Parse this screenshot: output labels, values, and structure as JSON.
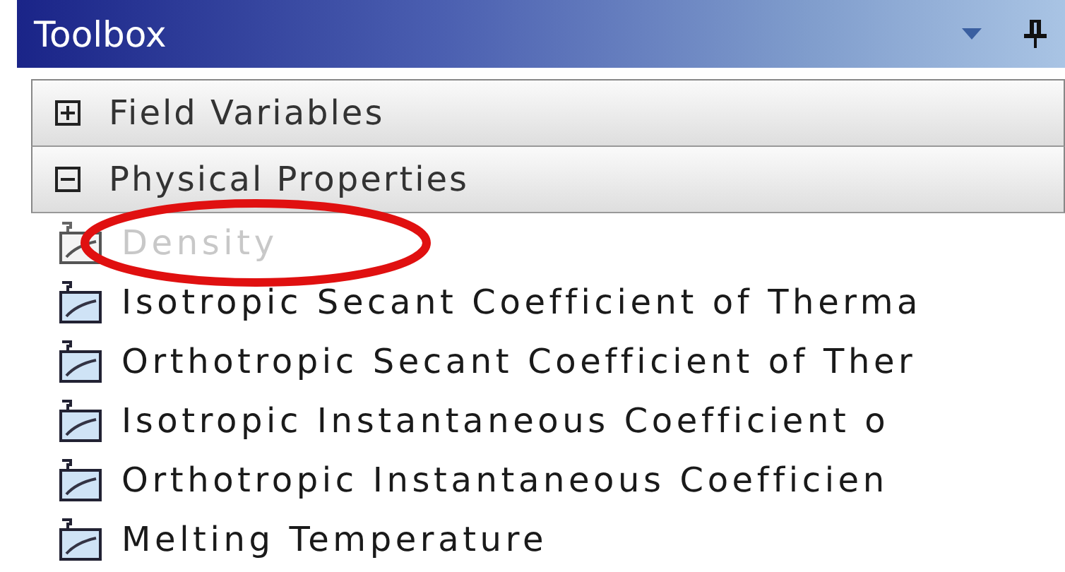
{
  "panel": {
    "title": "Toolbox"
  },
  "categories": [
    {
      "label": "Field Variables",
      "expanded": false
    },
    {
      "label": "Physical Properties",
      "expanded": true,
      "items": [
        {
          "label": "Density",
          "disabled": true
        },
        {
          "label": "Isotropic Secant Coefficient of Therma",
          "disabled": false
        },
        {
          "label": "Orthotropic Secant Coefficient of Ther",
          "disabled": false
        },
        {
          "label": "Isotropic Instantaneous Coefficient o",
          "disabled": false
        },
        {
          "label": "Orthotropic Instantaneous Coefficien",
          "disabled": false
        },
        {
          "label": "Melting Temperature",
          "disabled": false
        }
      ]
    }
  ]
}
